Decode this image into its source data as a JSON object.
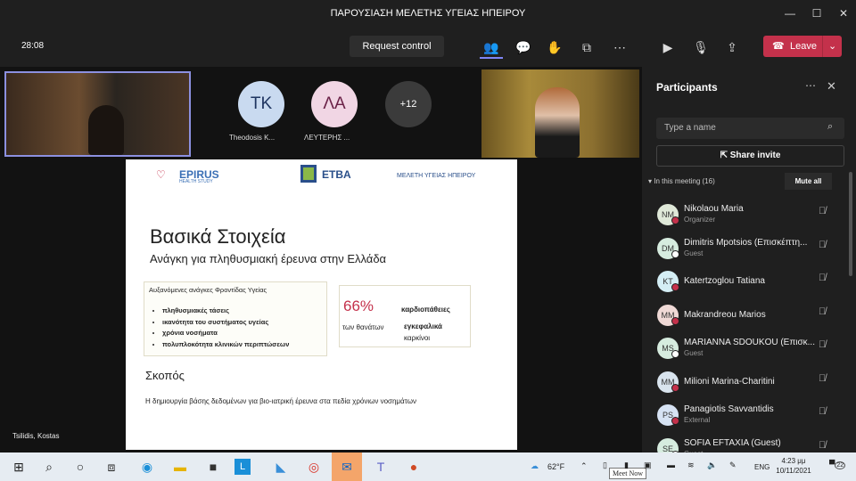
{
  "window": {
    "title": "ΠΑΡΟΥΣΙΑΣΗ ΜΕΛΕΤΗΣ ΥΓΕΙΑΣ ΗΠΕΙΡΟΥ"
  },
  "toolbar": {
    "timer": "28:08",
    "request_control": "Request control",
    "leave": "Leave"
  },
  "stage": {
    "tiles": [
      {
        "initials": "TK",
        "name": "Theodosis K...",
        "color": "#c9daf0"
      },
      {
        "initials": "ΛΑ",
        "name": "ΛΕΥΤΕΡΗΣ ...",
        "color": "#f1d6e4"
      }
    ],
    "overflow": "+12",
    "presenter": "Tsilidis, Kostas"
  },
  "slide": {
    "logo_left": "EPIRUS",
    "logo_left_sub": "HEALTH STUDY",
    "logo_mid": "ETBA",
    "header_right": "ΜΕΛΕΤΗ ΥΓΕΙΑΣ ΗΠΕΙΡΟΥ",
    "title": "Βασικά Στοιχεία",
    "subtitle": "Ανάγκη για πληθυσμιακή έρευνα στην Ελλάδα",
    "box1_title": "Αυξανόμενες ανάγκες Φροντίδας Υγείας",
    "bullets": [
      "πληθυσμιακές τάσεις",
      "ικανότητα του συστήματος υγείας",
      "χρόνια νοσήματα",
      "πολυπλοκότητα κλινικών περιπτώσεων"
    ],
    "stat": "66%",
    "stat_label": "των θανάτων",
    "causes": [
      "καρδιοπάθειες",
      "εγκεφαλικά",
      "καρκίνοι"
    ],
    "section": "Σκοπός",
    "body": "Η δημιουργία βάσης δεδομένων για βιο-ιατρική έρευνα στα πεδία χρόνιων νοσημάτων"
  },
  "panel": {
    "title": "Participants",
    "search_placeholder": "Type a name",
    "share_invite": "Share invite",
    "section": "In this meeting (16)",
    "mute_all": "Mute all",
    "participants": [
      {
        "initials": "NM",
        "name": "Nikolaou Maria",
        "role": "Organizer",
        "color": "#dfe8d8",
        "status": "#c4314b"
      },
      {
        "initials": "DM",
        "name": "Dimitris Mpotsios (Επισκέπτη...",
        "role": "Guest",
        "color": "#d6ecdf",
        "status": "#ffffff"
      },
      {
        "initials": "KT",
        "name": "Katertzoglou Tatiana",
        "role": "",
        "color": "#d4eef5",
        "status": "#c4314b"
      },
      {
        "initials": "MM",
        "name": "Makrandreou Marios",
        "role": "",
        "color": "#efd9d6",
        "status": "#c4314b"
      },
      {
        "initials": "MS",
        "name": "MARIANNA SDOUKOU (Επισκ...",
        "role": "Guest",
        "color": "#d6ecdf",
        "status": "#ffffff"
      },
      {
        "initials": "MM",
        "name": "Milioni Marina-Charitini",
        "role": "",
        "color": "#d9e4ee",
        "status": "#c4314b"
      },
      {
        "initials": "PS",
        "name": "Panagiotis Savvantidis",
        "role": "External",
        "color": "#d6e2f3",
        "status": "#c4314b"
      },
      {
        "initials": "SE",
        "name": "SOFIA EFTAXIA (Guest)",
        "role": "Guest",
        "color": "#d6ecdf",
        "status": "#ffffff"
      }
    ]
  },
  "taskbar": {
    "weather": "62°F",
    "tooltip": "Meet Now",
    "lang": "ENG",
    "time": "4:23 μμ",
    "date": "10/11/2021",
    "notifications": "22"
  },
  "colors": {
    "leave": "#c4314b",
    "accent": "#7f85f5"
  }
}
